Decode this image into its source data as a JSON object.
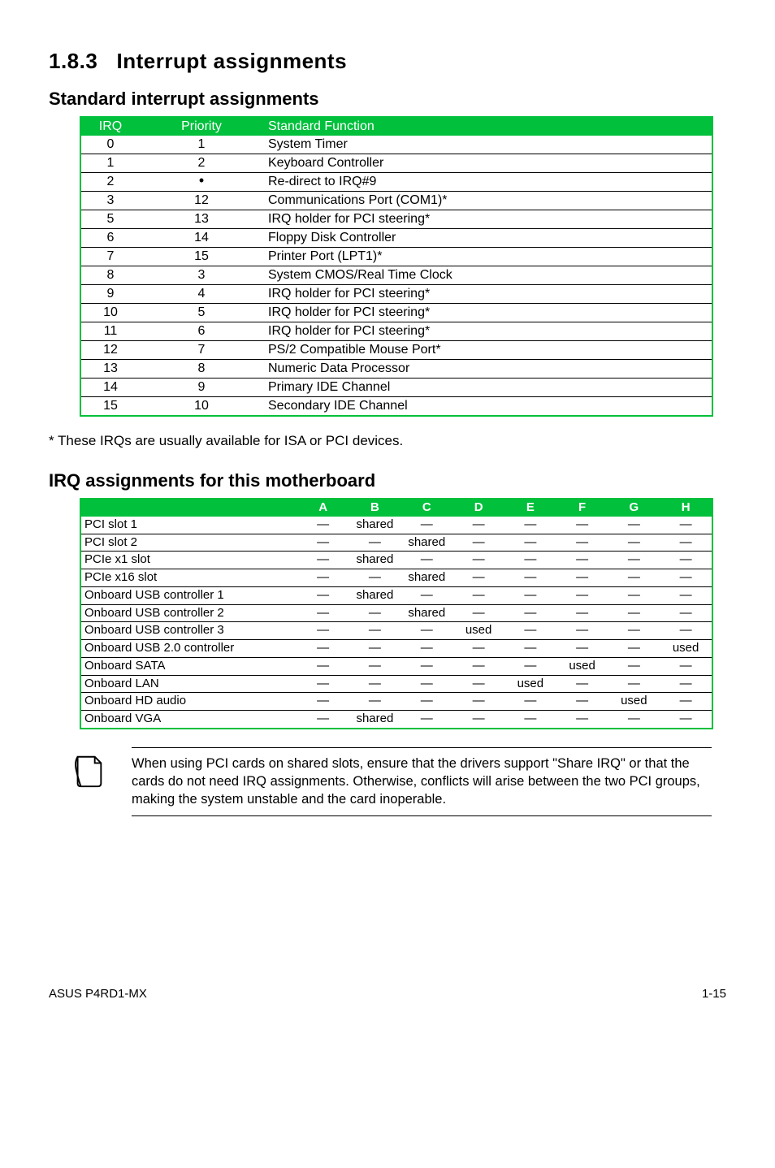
{
  "section_number": "1.8.3",
  "section_title": "Interrupt assignments",
  "subheading1": "Standard interrupt assignments",
  "t1_headers": {
    "irq": "IRQ",
    "priority": "Priority",
    "fn": "Standard Function"
  },
  "t1_rows": [
    {
      "irq": "0",
      "pri": "1",
      "fn": "System Timer"
    },
    {
      "irq": "1",
      "pri": "2",
      "fn": "Keyboard Controller"
    },
    {
      "irq": "2",
      "pri": "•",
      "fn": "Re-direct to IRQ#9"
    },
    {
      "irq": "3",
      "pri": "12",
      "fn": "Communications Port (COM1)*"
    },
    {
      "irq": "5",
      "pri": "13",
      "fn": "IRQ holder for PCI steering*"
    },
    {
      "irq": "6",
      "pri": "14",
      "fn": "Floppy Disk Controller"
    },
    {
      "irq": "7",
      "pri": "15",
      "fn": "Printer Port (LPT1)*"
    },
    {
      "irq": "8",
      "pri": "3",
      "fn": "System CMOS/Real Time Clock"
    },
    {
      "irq": "9",
      "pri": "4",
      "fn": "IRQ holder for PCI steering*"
    },
    {
      "irq": "10",
      "pri": "5",
      "fn": "IRQ holder for PCI steering*"
    },
    {
      "irq": "11",
      "pri": "6",
      "fn": "IRQ holder for PCI steering*"
    },
    {
      "irq": "12",
      "pri": "7",
      "fn": "PS/2 Compatible Mouse Port*"
    },
    {
      "irq": "13",
      "pri": "8",
      "fn": "Numeric Data Processor"
    },
    {
      "irq": "14",
      "pri": "9",
      "fn": "Primary IDE Channel"
    },
    {
      "irq": "15",
      "pri": "10",
      "fn": "Secondary IDE Channel"
    }
  ],
  "note_text": "* These IRQs are usually available for ISA or PCI devices.",
  "subheading2": "IRQ assignments for this motherboard",
  "t2_headers": [
    "A",
    "B",
    "C",
    "D",
    "E",
    "F",
    "G",
    "H"
  ],
  "t2_rows": [
    {
      "dev": "PCI slot 1",
      "v": [
        "—",
        "shared",
        "—",
        "—",
        "—",
        "—",
        "—",
        "—"
      ]
    },
    {
      "dev": "PCI slot 2",
      "v": [
        "—",
        "—",
        "shared",
        "—",
        "—",
        "—",
        "—",
        "—"
      ]
    },
    {
      "dev": "PCIe x1 slot",
      "v": [
        "—",
        "shared",
        "—",
        "—",
        "—",
        "—",
        "—",
        "—"
      ]
    },
    {
      "dev": "PCIe x16 slot",
      "v": [
        "—",
        "—",
        "shared",
        "—",
        "—",
        "—",
        "—",
        "—"
      ]
    },
    {
      "dev": "Onboard USB controller 1",
      "v": [
        "—",
        "shared",
        "—",
        "—",
        "—",
        "—",
        "—",
        "—"
      ]
    },
    {
      "dev": "Onboard USB controller 2",
      "v": [
        "—",
        "—",
        "shared",
        "—",
        "—",
        "—",
        "—",
        "—"
      ]
    },
    {
      "dev": "Onboard USB controller 3",
      "v": [
        "—",
        "—",
        "—",
        "used",
        "—",
        "—",
        "—",
        "—"
      ]
    },
    {
      "dev": "Onboard USB 2.0 controller",
      "v": [
        "—",
        "—",
        "—",
        "—",
        "—",
        "—",
        "—",
        "used"
      ]
    },
    {
      "dev": "Onboard SATA",
      "v": [
        "—",
        "—",
        "—",
        "—",
        "—",
        "used",
        "—",
        "—"
      ]
    },
    {
      "dev": "Onboard LAN",
      "v": [
        "—",
        "—",
        "—",
        "—",
        "used",
        "—",
        "—",
        "—"
      ]
    },
    {
      "dev": "Onboard HD audio",
      "v": [
        "—",
        "—",
        "—",
        "—",
        "—",
        "—",
        "used",
        "—"
      ]
    },
    {
      "dev": "Onboard VGA",
      "v": [
        "—",
        "shared",
        "—",
        "—",
        "—",
        "—",
        "—",
        "—"
      ]
    }
  ],
  "callout_text": "When using PCI cards on shared slots, ensure that the drivers support \"Share IRQ\" or that the cards do not need IRQ assignments. Otherwise, conflicts will arise between the two PCI groups, making the system unstable and the card inoperable.",
  "footer_model": "ASUS P4RD1-MX",
  "footer_page": "1-15"
}
